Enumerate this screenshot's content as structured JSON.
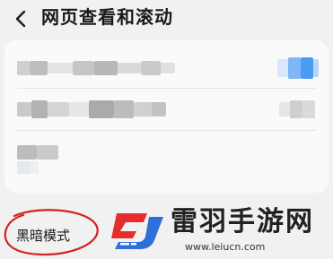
{
  "header": {
    "title": "网页查看和滚动",
    "back_icon": "chevron-left-icon"
  },
  "settings_card": {
    "rows": [
      {
        "label": "",
        "state": "pixelated",
        "toggle_color": "#4a9bf2"
      },
      {
        "label": "",
        "state": "pixelated"
      },
      {
        "label": "",
        "state": "pixelated"
      }
    ]
  },
  "annotation": {
    "label": "黑暗模式",
    "circle_color": "#d32222"
  },
  "watermark": {
    "name": "雷羽手游网",
    "url": "www.leiucn.com",
    "logo_colors": [
      "#e52d2d",
      "#2f6fd8"
    ]
  }
}
